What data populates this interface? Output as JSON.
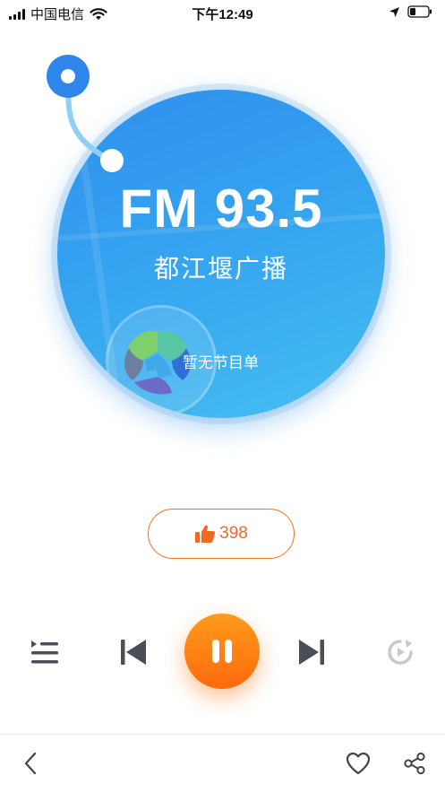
{
  "status_bar": {
    "carrier": "中国电信",
    "time": "下午12:49",
    "icons": [
      "signal-icon",
      "wifi-icon",
      "location-arrow-icon",
      "battery-icon"
    ]
  },
  "station": {
    "frequency": "FM 93.5",
    "name": "都江堰广播",
    "program_status": "暂无节目单",
    "logo_icon": "station-logo-icon"
  },
  "like": {
    "count": "398",
    "icon": "thumbs-up-icon"
  },
  "controls": {
    "playlist_icon": "playlist-icon",
    "previous_icon": "skip-previous-icon",
    "play_state_icon": "pause-icon",
    "next_icon": "skip-next-icon",
    "loop_icon": "loop-icon"
  },
  "bottom_bar": {
    "back_icon": "back-chevron-icon",
    "favorite_icon": "heart-icon",
    "share_icon": "share-icon"
  },
  "colors": {
    "disc_primary": "#2f8fee",
    "disc_secondary": "#45bff0",
    "accent_orange": "#ff6a0d",
    "like_text": "#f06a24",
    "icon_gray": "#4a4f57"
  }
}
